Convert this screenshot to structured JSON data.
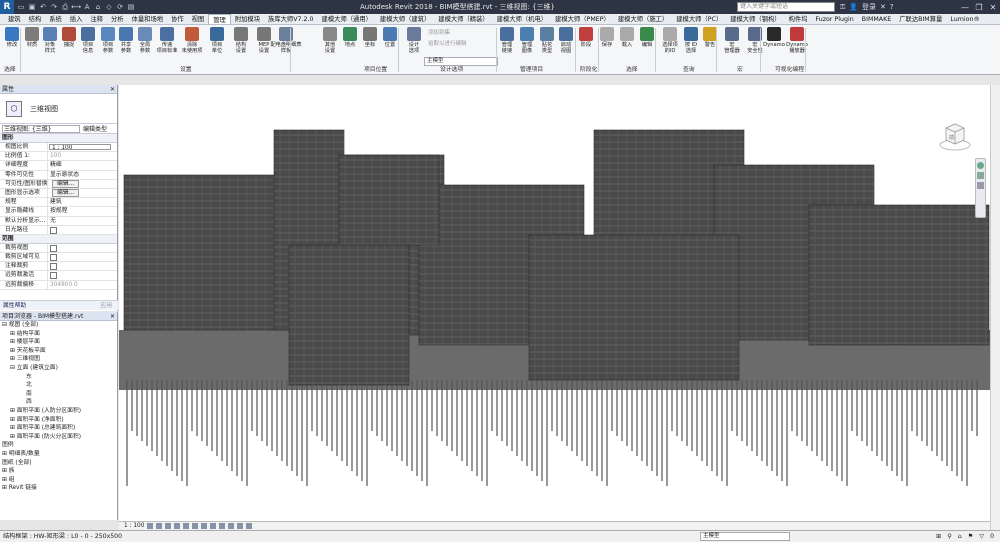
{
  "titlebar": {
    "logo": "R",
    "title": "Autodesk Revit 2018 -   BIM模型搭建.rvt - 三维视图: {三维}",
    "search_placeholder": "键入关键字或短语",
    "login": "登录",
    "qat_icons": [
      "open-icon",
      "save-icon",
      "undo-icon",
      "redo-icon",
      "print-icon",
      "measure-icon",
      "text-icon",
      "3d-icon",
      "section-icon",
      "sync-icon",
      "switch-windows-icon"
    ]
  },
  "menu": {
    "tabs": [
      "建筑",
      "结构",
      "系统",
      "插入",
      "注释",
      "分析",
      "体量和场地",
      "协作",
      "视图",
      "管理",
      "附加模块",
      "族库大师V7.2.0",
      "建模大师（通用）",
      "建模大师（建筑）",
      "建模大师（精装）",
      "建模大师（机电）",
      "建模大师（PMEP）",
      "建模大师（施工）",
      "建模大师（PC）",
      "建模大师（钢构）",
      "构件坞",
      "Fuzor Plugin",
      "BIMMAKE",
      "广联达BIM算量",
      "Lumion®"
    ],
    "active_index": 9
  },
  "ribbon": {
    "buttons": [
      {
        "label": "修改",
        "icon": "modify-icon",
        "color": "#3a78c2"
      },
      {
        "label": "材质",
        "icon": "materials-icon",
        "color": "#7c7c7c"
      },
      {
        "label": "对象\n样式",
        "icon": "object-styles-icon",
        "color": "#5a7fb5"
      },
      {
        "label": "捕捉",
        "icon": "snaps-icon",
        "color": "#b04a3a"
      },
      {
        "label": "项目\n信息",
        "icon": "project-info-icon",
        "color": "#4a6f9f"
      },
      {
        "label": "项目\n参数",
        "icon": "project-params-icon",
        "color": "#5a87c0"
      },
      {
        "label": "共享\n参数",
        "icon": "shared-params-icon",
        "color": "#4a77b0"
      },
      {
        "label": "全局\n参数",
        "icon": "global-params-icon",
        "color": "#6a8ab8"
      },
      {
        "label": "传递\n项目标准",
        "icon": "transfer-standards-icon",
        "color": "#4a6fa0"
      },
      {
        "label": "清除\n未使用项",
        "icon": "purge-icon",
        "color": "#c05a3a"
      },
      {
        "label": "项目\n单位",
        "icon": "project-units-icon",
        "color": "#3a6a9a"
      },
      {
        "label": "结构\n设置",
        "icon": "structural-settings-icon",
        "color": "#777"
      },
      {
        "label": "MEP\n设置",
        "icon": "mep-settings-icon",
        "color": "#777"
      },
      {
        "label": "配电盘明细表\n样板",
        "icon": "panel-schedule-icon",
        "color": "#6a7f9a"
      },
      {
        "label": "其他\n设置",
        "icon": "other-settings-icon",
        "color": "#888"
      },
      {
        "label": "地点",
        "icon": "location-icon",
        "color": "#3a8a5a"
      },
      {
        "label": "坐标",
        "icon": "coordinates-icon",
        "color": "#777"
      },
      {
        "label": "位置",
        "icon": "position-icon",
        "color": "#4a7ab0"
      },
      {
        "label": "设计\n选项",
        "icon": "design-options-icon",
        "color": "#6a7a9a"
      },
      {
        "label": "管理\n链接",
        "icon": "manage-links-icon",
        "color": "#4a6f9f"
      },
      {
        "label": "管理\n图像",
        "icon": "manage-images-icon",
        "color": "#4a7fb0"
      },
      {
        "label": "贴花\n类型",
        "icon": "decal-types-icon",
        "color": "#5a7fa0"
      },
      {
        "label": "启动\n视图",
        "icon": "starting-view-icon",
        "color": "#4a6f9f"
      },
      {
        "label": "阶段",
        "icon": "phases-icon",
        "color": "#c04040"
      },
      {
        "label": "保存",
        "icon": "save-selection-icon",
        "color": "#aaa"
      },
      {
        "label": "载入",
        "icon": "load-selection-icon",
        "color": "#aaa"
      },
      {
        "label": "编辑",
        "icon": "edit-selection-icon",
        "color": "#3a8a4a"
      },
      {
        "label": "选择项\n的ID",
        "icon": "ids-of-selection-icon",
        "color": "#aaa"
      },
      {
        "label": "按 ID\n选择",
        "icon": "select-by-id-icon",
        "color": "#3a6a9a"
      },
      {
        "label": "警告",
        "icon": "warnings-icon",
        "color": "#d0a020"
      },
      {
        "label": "宏\n管理器",
        "icon": "macro-manager-icon",
        "color": "#5a6a8a"
      },
      {
        "label": "宏\n安全性",
        "icon": "macro-security-icon",
        "color": "#5a6a8a"
      },
      {
        "label": "Dynamo",
        "icon": "dynamo-icon",
        "color": "#2a2a2a"
      },
      {
        "label": "Dynamo\n播放器",
        "icon": "dynamo-player-icon",
        "color": "#c03a3a"
      }
    ],
    "groups": [
      "选择",
      "设置",
      "项目位置",
      "设计选项",
      "管理项目",
      "阶段化",
      "选择",
      "查询",
      "宏",
      "可视化编程"
    ],
    "small": {
      "add_to_set": "添加到集",
      "pick_to_edit": "拾取以进行编辑",
      "main_model": "主模型"
    }
  },
  "properties": {
    "header": "属性",
    "type_name": "三维视图",
    "selector": "三维视图: {三维}",
    "edit_type": "编辑类型",
    "sections": [
      {
        "name": "图形",
        "rows": [
          {
            "k": "视图比例",
            "v": "1 : 100",
            "kind": "box"
          },
          {
            "k": "比例值 1:",
            "v": "100",
            "kind": "grey"
          },
          {
            "k": "详细程度",
            "v": "精细",
            "kind": "text"
          },
          {
            "k": "零件可见性",
            "v": "显示原状态",
            "kind": "text"
          },
          {
            "k": "可见性/图形替换",
            "v": "编辑...",
            "kind": "btn"
          },
          {
            "k": "图形显示选项",
            "v": "编辑...",
            "kind": "btn"
          },
          {
            "k": "规程",
            "v": "建筑",
            "kind": "text"
          },
          {
            "k": "显示隐藏线",
            "v": "按规程",
            "kind": "text"
          },
          {
            "k": "默认分析显示...",
            "v": "无",
            "kind": "text"
          },
          {
            "k": "日光路径",
            "v": "",
            "kind": "chk"
          }
        ]
      },
      {
        "name": "范围",
        "rows": [
          {
            "k": "裁剪视图",
            "v": "",
            "kind": "chk"
          },
          {
            "k": "裁剪区域可见",
            "v": "",
            "kind": "chk"
          },
          {
            "k": "注释裁剪",
            "v": "",
            "kind": "chk"
          },
          {
            "k": "远剪裁激活",
            "v": "",
            "kind": "chk"
          },
          {
            "k": "远剪裁偏移",
            "v": "304800.0",
            "kind": "grey"
          }
        ]
      }
    ],
    "help": "属性帮助",
    "apply": "应用"
  },
  "browser": {
    "header": "项目浏览器 - BIM模型搭建.rvt",
    "items": [
      {
        "t": "视图 (全部)",
        "lvl": 0,
        "exp": "⊟"
      },
      {
        "t": "结构平面",
        "lvl": 1,
        "exp": "⊞"
      },
      {
        "t": "楼层平面",
        "lvl": 1,
        "exp": "⊞"
      },
      {
        "t": "天花板平面",
        "lvl": 1,
        "exp": "⊞"
      },
      {
        "t": "三维视图",
        "lvl": 1,
        "exp": "⊞"
      },
      {
        "t": "立面 (建筑立面)",
        "lvl": 1,
        "exp": "⊟"
      },
      {
        "t": "东",
        "lvl": 3,
        "exp": ""
      },
      {
        "t": "北",
        "lvl": 3,
        "exp": ""
      },
      {
        "t": "南",
        "lvl": 3,
        "exp": ""
      },
      {
        "t": "西",
        "lvl": 3,
        "exp": ""
      },
      {
        "t": "面积平面 (人防分区面积)",
        "lvl": 1,
        "exp": "⊞"
      },
      {
        "t": "面积平面 (净面积)",
        "lvl": 1,
        "exp": "⊞"
      },
      {
        "t": "面积平面 (总建筑面积)",
        "lvl": 1,
        "exp": "⊞"
      },
      {
        "t": "面积平面 (防火分区面积)",
        "lvl": 1,
        "exp": "⊞"
      },
      {
        "t": "图例",
        "lvl": 0,
        "exp": ""
      },
      {
        "t": "明细表/数量",
        "lvl": 0,
        "exp": "⊞"
      },
      {
        "t": "图纸 (全部)",
        "lvl": 0,
        "exp": ""
      },
      {
        "t": "族",
        "lvl": 0,
        "exp": "⊞"
      },
      {
        "t": "组",
        "lvl": 0,
        "exp": "⊞"
      },
      {
        "t": "Revit 链接",
        "lvl": 0,
        "exp": "⊞"
      }
    ]
  },
  "viewbar": {
    "scale": "1 : 100"
  },
  "statusbar": {
    "text": "结构框架 : HW-矩形梁 : L0 - 0 - 250x500",
    "model": "主模型",
    "filter": "0"
  },
  "viewcube": {
    "label": "前"
  }
}
